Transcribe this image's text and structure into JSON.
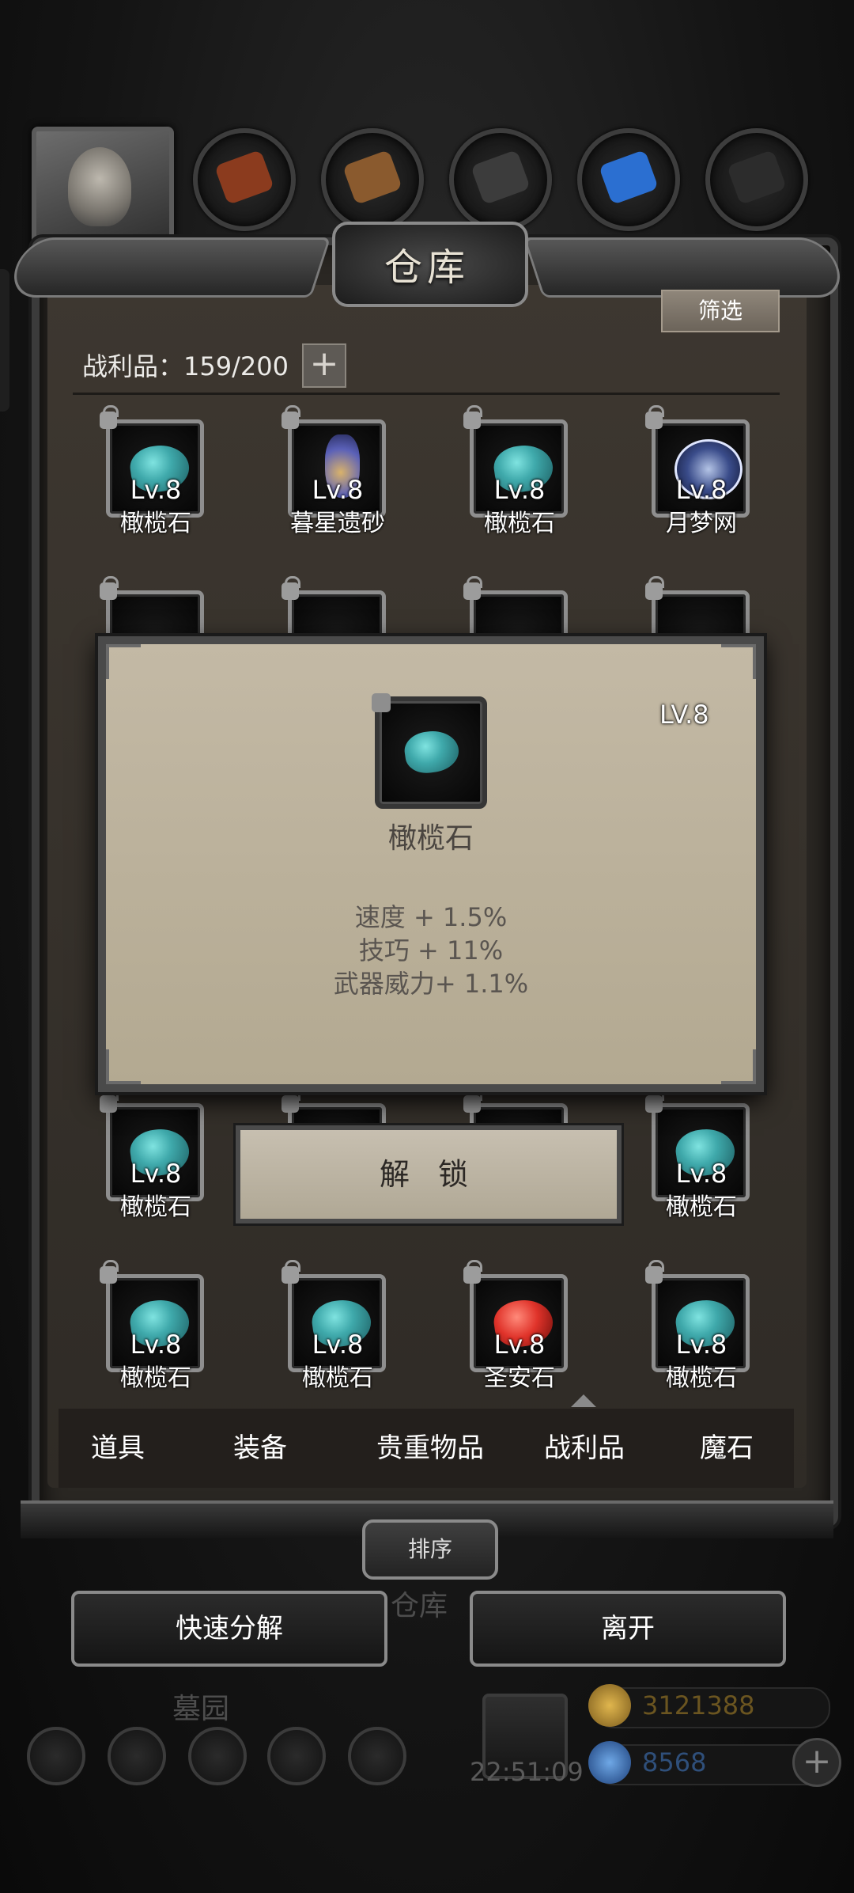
{
  "top_bar": {
    "resources": [
      {
        "icon": "copper-ore-icon",
        "color": "#8b3b1e"
      },
      {
        "icon": "wood-plank-icon",
        "color": "#8a5a2e"
      },
      {
        "icon": "iron-ingot-icon",
        "color": "#3c3c3c"
      },
      {
        "icon": "crystal-icon",
        "color": "#2b6fd1"
      },
      {
        "icon": "steel-ingot-icon",
        "color": "#2c2c2c"
      }
    ]
  },
  "panel": {
    "title": "仓库",
    "filter_label": "筛选",
    "loot_count": "战利品：159/200",
    "plus_label": "+"
  },
  "grid": {
    "row1": [
      {
        "level": "Lv.8",
        "name": "橄榄石",
        "icon": "olivine-gem-icon"
      },
      {
        "level": "Lv.8",
        "name": "暮星遗砂",
        "icon": "potion-bottle-icon"
      },
      {
        "level": "Lv.8",
        "name": "橄榄石",
        "icon": "olivine-gem-icon"
      },
      {
        "level": "Lv.8",
        "name": "月梦网",
        "icon": "dreamcatcher-icon"
      }
    ],
    "row4": [
      {
        "level": "Lv.8",
        "name": "橄榄石",
        "icon": "olivine-gem-icon"
      },
      {
        "level": "Lv.8",
        "name": "橄榄石",
        "icon": "olivine-gem-icon"
      }
    ],
    "row5": [
      {
        "level": "Lv.8",
        "name": "橄榄石",
        "icon": "olivine-gem-icon"
      },
      {
        "level": "Lv.8",
        "name": "橄榄石",
        "icon": "olivine-gem-icon"
      },
      {
        "level": "Lv.8",
        "name": "圣安石",
        "icon": "ruby-gem-icon"
      },
      {
        "level": "Lv.8",
        "name": "橄榄石",
        "icon": "olivine-gem-icon"
      }
    ]
  },
  "popup": {
    "level": "LV.8",
    "item_name": "橄榄石",
    "stats": [
      "速度 + 1.5%",
      "技巧 + 11%",
      "武器威力+ 1.1%"
    ],
    "unlock_label": "解 锁"
  },
  "tabs": {
    "items": [
      "道具",
      "装备",
      "贵重物品",
      "战利品",
      "魔石"
    ],
    "active": "战利品"
  },
  "sort_label": "排序",
  "background": {
    "warehouse_label": "仓库",
    "graveyard_label": "墓园",
    "time": "22:51:09",
    "gold": "3121388",
    "gems": "8568"
  },
  "actions": {
    "quick_decompose": "快速分解",
    "leave": "离开"
  },
  "colors": {
    "gold": "#c89b3a",
    "gem": "#3a78c8",
    "accent_gem": "#3fa9ab"
  }
}
